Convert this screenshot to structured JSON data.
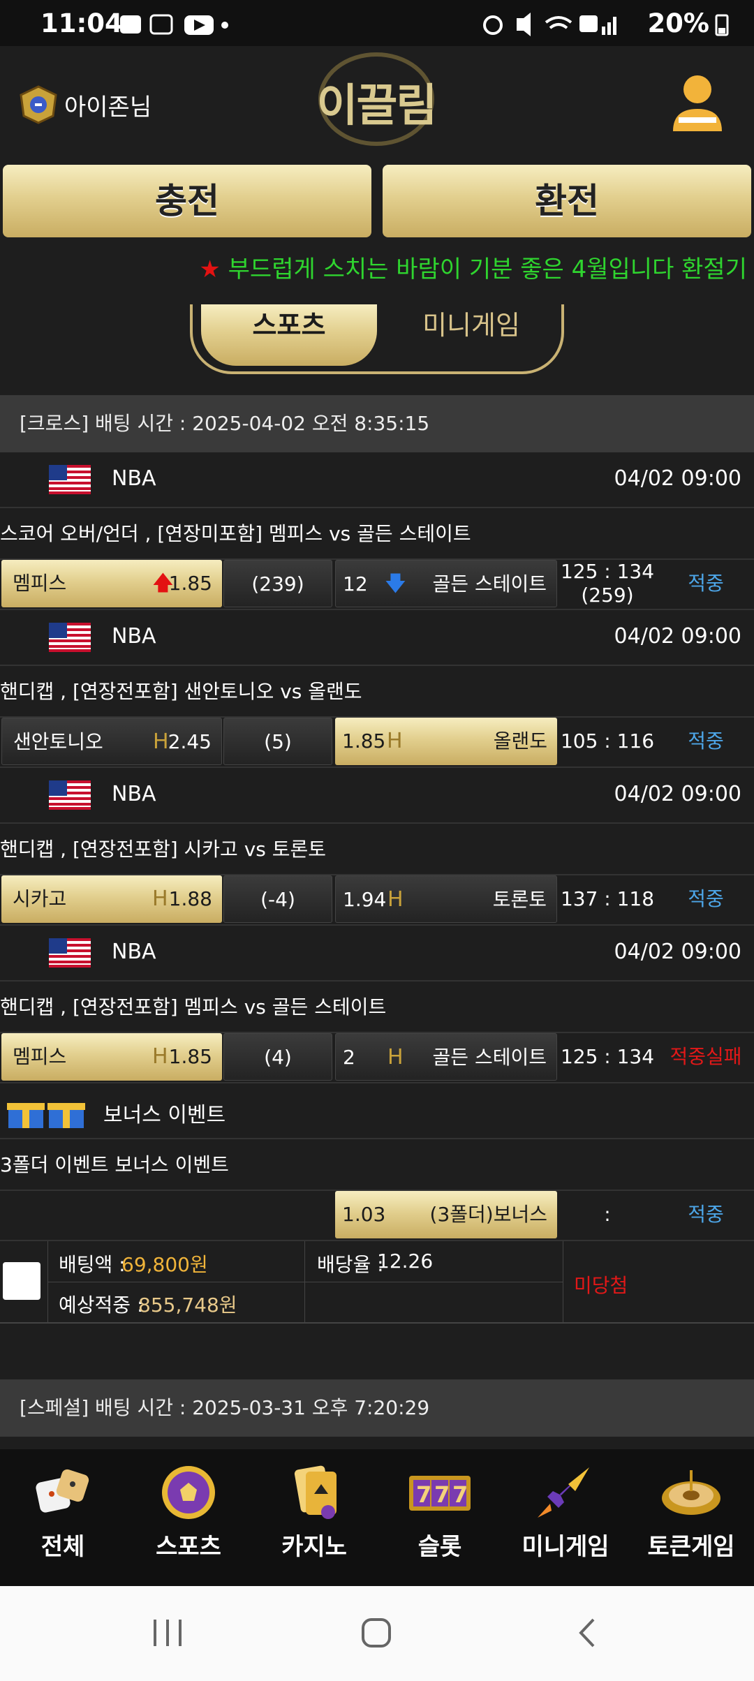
{
  "status": {
    "time": "11:04",
    "battery": "20%"
  },
  "header": {
    "user": "아이존님",
    "logo": "이끌림"
  },
  "buttons": {
    "charge": "충전",
    "exchange": "환전"
  },
  "ticker": {
    "star": "★",
    "text": "부드럽게 스치는 바람이 기분 좋은 4월입니다 환절기"
  },
  "tabs": {
    "sports": "스포츠",
    "mini": "미니게임"
  },
  "bet1": {
    "header": "[크로스] 배팅 시간 : 2025-04-02 오전 8:35:15",
    "games": [
      {
        "league": "NBA",
        "datetime": "04/02 09:00",
        "market": "스코어 오버/언더 , [연장미포함] 멤피스  vs  골든 스테이트",
        "home": "멤피스",
        "home_odds": "1.85",
        "mid": "(239)",
        "away_odds": "12",
        "away": "골든 스테이트",
        "score1": "125 : 134",
        "score2": "(259)",
        "result": "적중"
      },
      {
        "league": "NBA",
        "datetime": "04/02 09:00",
        "market": "핸디캡 , [연장전포함] 샌안토니오  vs  올랜도",
        "home": "샌안토니오",
        "home_odds": "2.45",
        "mid": "(5)",
        "away_odds": "1.85",
        "away": "올랜도",
        "score1": "105 : 116",
        "result": "적중"
      },
      {
        "league": "NBA",
        "datetime": "04/02 09:00",
        "market": "핸디캡 , [연장전포함] 시카고  vs  토론토",
        "home": "시카고",
        "home_odds": "1.88",
        "mid": "(-4)",
        "away_odds": "1.94",
        "away": "토론토",
        "score1": "137 : 118",
        "result": "적중"
      },
      {
        "league": "NBA",
        "datetime": "04/02 09:00",
        "market": "핸디캡 , [연장전포함] 멤피스  vs  골든 스테이트",
        "home": "멤피스",
        "home_odds": "1.85",
        "mid": "(4)",
        "away_odds": "2",
        "away": "골든 스테이트",
        "score1": "125 : 134",
        "result": "적중실패"
      }
    ],
    "bonus": {
      "title": "보너스 이벤트",
      "market": "3폴더 이벤트 보너스 이벤트",
      "odds": "1.03",
      "label": "(3폴더)보너스",
      "score": ":",
      "result": "적중"
    },
    "summary": {
      "bet_label": "배팅액 :",
      "bet_value": "69,800원",
      "rate_label": "배당율 :",
      "rate_value": "12.26",
      "expect_label": "예상적중 :",
      "expect_value": "855,748원",
      "status": "미당첨"
    }
  },
  "bet2": {
    "header": "[스페셜] 배팅 시간 : 2025-03-31 오후 7:20:29"
  },
  "nav": [
    "전체",
    "스포츠",
    "카지노",
    "슬롯",
    "미니게임",
    "토큰게임"
  ],
  "colors": {
    "gold": "#e2cf8e",
    "win": "#4da6e8",
    "fail": "#e21818",
    "ticker": "#2fd52f"
  }
}
